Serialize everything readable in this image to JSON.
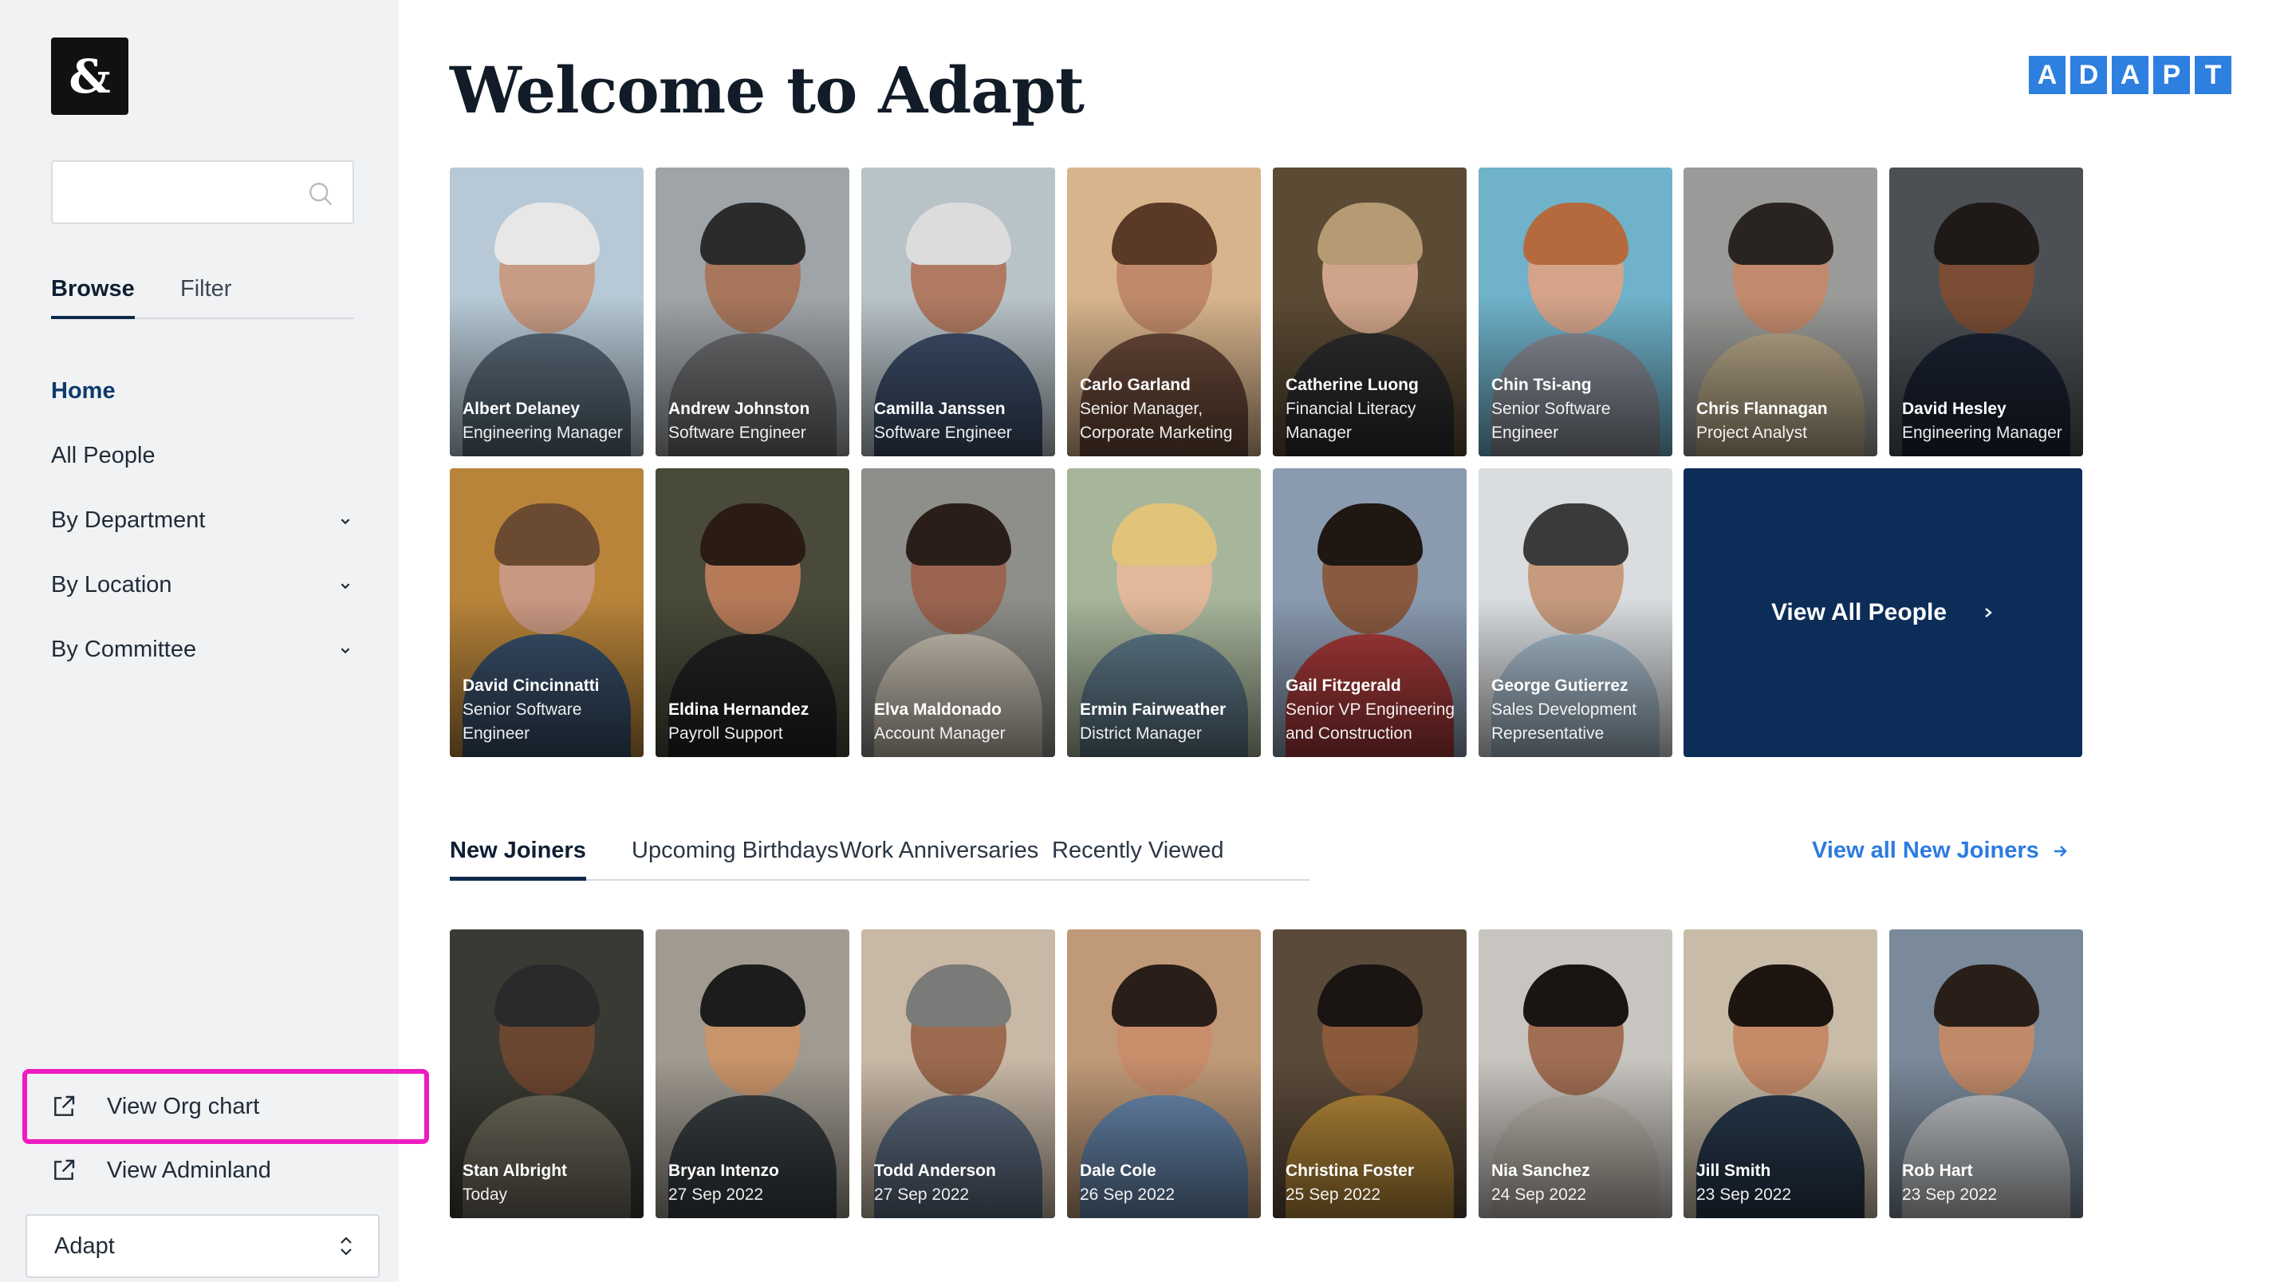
{
  "sidebar": {
    "logo": "&",
    "search": {
      "placeholder": "",
      "value": ""
    },
    "tabs": [
      {
        "label": "Browse",
        "active": true
      },
      {
        "label": "Filter",
        "active": false
      }
    ],
    "nav": [
      {
        "label": "Home",
        "active": true,
        "expandable": false
      },
      {
        "label": "All People",
        "active": false,
        "expandable": false
      },
      {
        "label": "By Department",
        "active": false,
        "expandable": true
      },
      {
        "label": "By Location",
        "active": false,
        "expandable": true
      },
      {
        "label": "By Committee",
        "active": false,
        "expandable": true
      }
    ],
    "links": [
      {
        "label": "View Org chart",
        "icon": "external-link-icon"
      },
      {
        "label": "View Adminland",
        "icon": "external-link-icon"
      }
    ],
    "select": {
      "value": "Adapt"
    }
  },
  "header": {
    "title": "Welcome to Adapt",
    "brand_letters": [
      "A",
      "D",
      "A",
      "P",
      "T"
    ]
  },
  "people": [
    {
      "name": "Albert Delaney",
      "role": "Engineering Manager"
    },
    {
      "name": "Andrew Johnston",
      "role": "Software Engineer"
    },
    {
      "name": "Camilla Janssen",
      "role": "Software Engineer"
    },
    {
      "name": "Carlo Garland",
      "role": "Senior Manager, Corporate Marketing"
    },
    {
      "name": "Catherine Luong",
      "role": "Financial Literacy Manager"
    },
    {
      "name": "Chin Tsi-ang",
      "role": "Senior Software Engineer"
    },
    {
      "name": "Chris Flannagan",
      "role": "Project Analyst"
    },
    {
      "name": "David Hesley",
      "role": "Engineering Manager"
    },
    {
      "name": "David Cincinnatti",
      "role": "Senior Software Engineer"
    },
    {
      "name": "Eldina Hernandez",
      "role": "Payroll Support"
    },
    {
      "name": "Elva Maldonado",
      "role": "Account Manager"
    },
    {
      "name": "Ermin Fairweather",
      "role": "District Manager"
    },
    {
      "name": "Gail Fitzgerald",
      "role": "Senior VP Engineering and Construction"
    },
    {
      "name": "George Gutierrez",
      "role": "Sales Development Representative"
    }
  ],
  "view_all_people": "View All People",
  "tabs": [
    {
      "label": "New Joiners",
      "active": true
    },
    {
      "label": "Upcoming Birthdays",
      "active": false
    },
    {
      "label": "Work Anniversaries",
      "active": false
    },
    {
      "label": "Recently Viewed",
      "active": false
    }
  ],
  "view_all_new_joiners": "View all New Joiners",
  "new_joiners": [
    {
      "name": "Stan Albright",
      "date": "Today"
    },
    {
      "name": "Bryan Intenzo",
      "date": "27 Sep 2022"
    },
    {
      "name": "Todd Anderson",
      "date": "27 Sep 2022"
    },
    {
      "name": "Dale Cole",
      "date": "26 Sep 2022"
    },
    {
      "name": "Christina Foster",
      "date": "25 Sep 2022"
    },
    {
      "name": "Nia Sanchez",
      "date": "24 Sep 2022"
    },
    {
      "name": "Jill Smith",
      "date": "23 Sep 2022"
    },
    {
      "name": "Rob Hart",
      "date": "23 Sep 2022"
    }
  ],
  "colors": {
    "accent": "#2c7be0",
    "navy": "#0d2d59",
    "highlight": "#ee1cc0",
    "sidebar_bg": "#f1f2f4"
  }
}
